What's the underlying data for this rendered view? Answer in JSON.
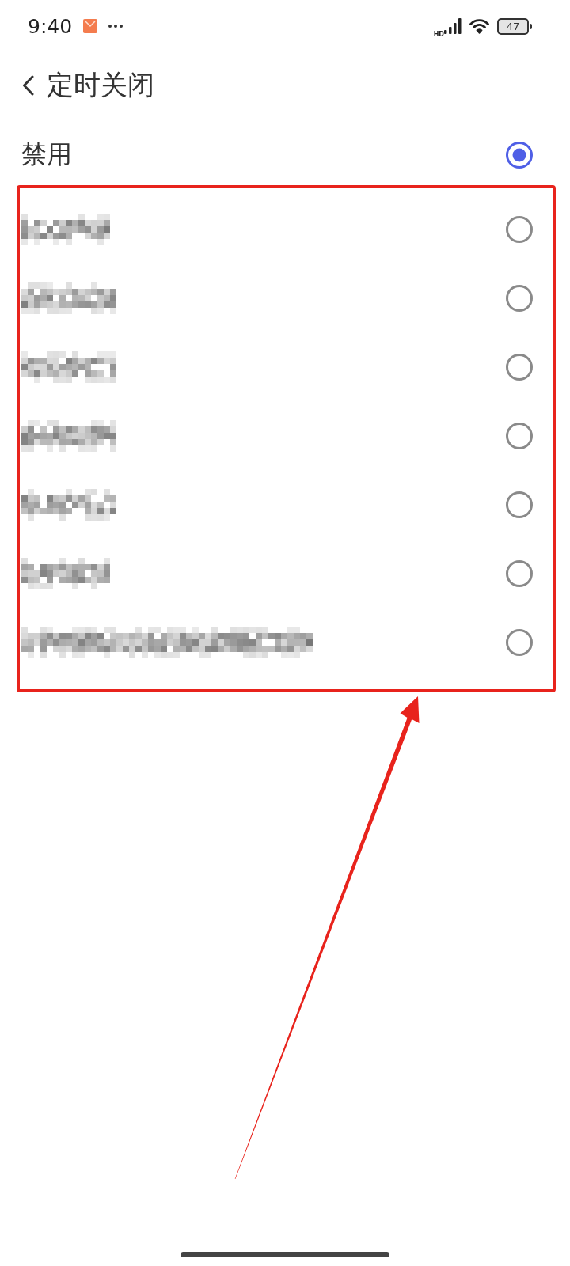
{
  "status_bar": {
    "time": "9:40",
    "network_type": "HD",
    "battery": "47"
  },
  "header": {
    "title": "定时关闭"
  },
  "options": [
    {
      "kind": "text",
      "label": "禁用",
      "selected": true
    }
  ],
  "framed_options": [
    {
      "kind": "pixelated",
      "selected": false
    },
    {
      "kind": "pixelated",
      "selected": false
    },
    {
      "kind": "pixelated",
      "selected": false
    },
    {
      "kind": "pixelated",
      "selected": false
    },
    {
      "kind": "pixelated",
      "selected": false
    },
    {
      "kind": "pixelated",
      "selected": false
    },
    {
      "kind": "pixelated",
      "selected": false
    }
  ]
}
